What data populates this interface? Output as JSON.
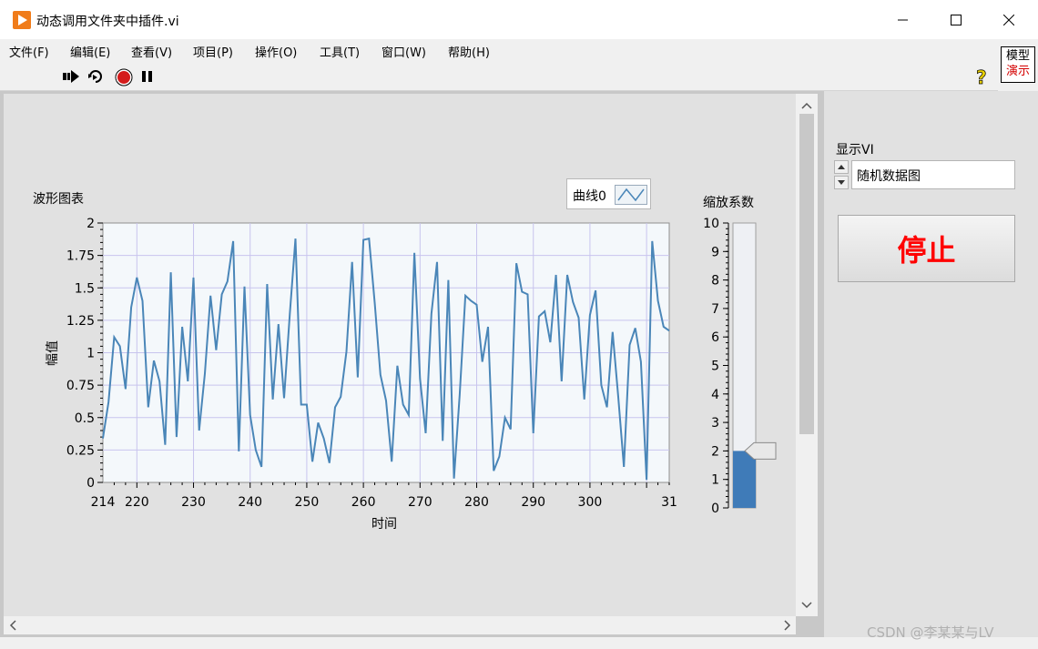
{
  "window": {
    "title": "动态调用文件夹中插件.vi"
  },
  "menu": {
    "items": [
      "文件(F)",
      "编辑(E)",
      "查看(V)",
      "项目(P)",
      "操作(O)",
      "工具(T)",
      "窗口(W)",
      "帮助(H)"
    ]
  },
  "toolbar": {
    "icons": [
      "run-arrow-icon",
      "run-continuously-icon",
      "abort-icon",
      "pause-icon"
    ],
    "help_icon": "question-icon"
  },
  "mode_indicator": {
    "line1": "模型",
    "line2": "演示"
  },
  "colors": {
    "plot_line": "#4a86b8",
    "stop_text": "#ff0000",
    "slider_fill": "#3f7bb8"
  },
  "chart_data": {
    "type": "line",
    "title": "波形图表",
    "xlabel": "时间",
    "ylabel": "幅值",
    "xlim": [
      214,
      314
    ],
    "ylim": [
      0,
      2
    ],
    "x_ticks": [
      214,
      220,
      230,
      240,
      250,
      260,
      270,
      280,
      290,
      300,
      31
    ],
    "y_ticks": [
      "0",
      "0.25",
      "0.5",
      "0.75",
      "1",
      "1.25",
      "1.5",
      "1.75",
      "2"
    ],
    "legend": [
      "曲线0"
    ],
    "grid": true,
    "series": [
      {
        "name": "曲线0",
        "x": [
          214,
          215,
          216,
          217,
          218,
          219,
          220,
          221,
          222,
          223,
          224,
          225,
          226,
          227,
          228,
          229,
          230,
          231,
          232,
          233,
          234,
          235,
          236,
          237,
          238,
          239,
          240,
          241,
          242,
          243,
          244,
          245,
          246,
          247,
          248,
          249,
          250,
          251,
          252,
          253,
          254,
          255,
          256,
          257,
          258,
          259,
          260,
          261,
          262,
          263,
          264,
          265,
          266,
          267,
          268,
          269,
          270,
          271,
          272,
          273,
          274,
          275,
          276,
          277,
          278,
          279,
          280,
          281,
          282,
          283,
          284,
          285,
          286,
          287,
          288,
          289,
          290,
          291,
          292,
          293,
          294,
          295,
          296,
          297,
          298,
          299,
          300,
          301,
          302,
          303,
          304,
          305,
          306,
          307,
          308,
          309,
          310,
          311,
          312,
          313,
          314
        ],
        "y": [
          0.34,
          0.62,
          1.12,
          1.05,
          0.72,
          1.35,
          1.58,
          1.4,
          0.58,
          0.94,
          0.78,
          0.29,
          1.62,
          0.35,
          1.2,
          0.78,
          1.58,
          0.4,
          0.84,
          1.44,
          1.02,
          1.45,
          1.55,
          1.86,
          0.24,
          1.51,
          0.52,
          0.25,
          0.12,
          1.53,
          0.64,
          1.22,
          0.65,
          1.3,
          1.88,
          0.6,
          0.6,
          0.16,
          0.46,
          0.34,
          0.15,
          0.58,
          0.66,
          1.01,
          1.7,
          0.81,
          1.87,
          1.88,
          1.38,
          0.83,
          0.63,
          0.16,
          0.9,
          0.6,
          0.52,
          1.77,
          0.8,
          0.38,
          1.3,
          1.7,
          0.32,
          1.56,
          0.03,
          0.68,
          1.44,
          1.4,
          1.37,
          0.93,
          1.2,
          0.09,
          0.2,
          0.5,
          0.41,
          1.69,
          1.47,
          1.45,
          0.38,
          1.28,
          1.32,
          1.08,
          1.6,
          0.78,
          1.6,
          1.39,
          1.27,
          0.64,
          1.29,
          1.48,
          0.75,
          0.58,
          1.16,
          0.66,
          0.12,
          1.06,
          1.19,
          0.93,
          0.02,
          1.86,
          1.4,
          1.2,
          1.17
        ]
      }
    ]
  },
  "slider": {
    "label": "缩放系数",
    "value": 2,
    "min": 0,
    "max": 10,
    "ticks": [
      "10",
      "9",
      "8",
      "7",
      "6",
      "5",
      "4",
      "3",
      "2",
      "1",
      "0"
    ]
  },
  "ring_control": {
    "label": "显示VI",
    "value": "随机数据图"
  },
  "stop_button": {
    "label": "停止"
  },
  "watermark": "CSDN @李某某与LV"
}
